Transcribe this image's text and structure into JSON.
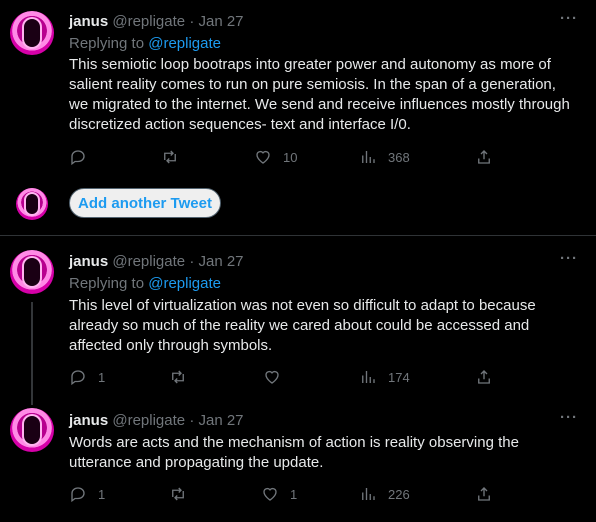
{
  "tweets": [
    {
      "name": "janus",
      "handle": "@repligate",
      "separator": "·",
      "date": "Jan 27",
      "more": "···",
      "replying_label": "Replying to",
      "replying_handle": "@repligate",
      "text": "This semiotic loop bootraps into greater power and autonomy as more of salient reality comes to run on pure semiosis. In the span of a generation, we migrated to the internet. We send and receive influences mostly through discretized action sequences- text and interface I/0.",
      "replies": "",
      "retweets": "",
      "likes": "10",
      "views": "368"
    },
    {
      "name": "janus",
      "handle": "@repligate",
      "separator": "·",
      "date": "Jan 27",
      "more": "···",
      "replying_label": "Replying to",
      "replying_handle": "@repligate",
      "text": "This level of virtualization was not even so difficult to adapt to because already so much of the reality we cared about could be accessed and affected only through symbols.",
      "replies": "1",
      "retweets": "",
      "likes": "",
      "views": "174"
    },
    {
      "name": "janus",
      "handle": "@repligate",
      "separator": "·",
      "date": "Jan 27",
      "more": "···",
      "text": "Words are acts and the mechanism of action is reality observing the utterance and propagating the update.",
      "replies": "1",
      "retweets": "",
      "likes": "1",
      "views": "226"
    }
  ],
  "composer": {
    "add_button_label": "Add another Tweet"
  },
  "icons": {
    "reply": "reply-icon",
    "retweet": "retweet-icon",
    "like": "heart-icon",
    "views": "views-icon",
    "share": "share-icon"
  },
  "colors": {
    "background": "#000000",
    "text": "#e7e9ea",
    "muted": "#71767b",
    "accent": "#1d9bf0"
  }
}
